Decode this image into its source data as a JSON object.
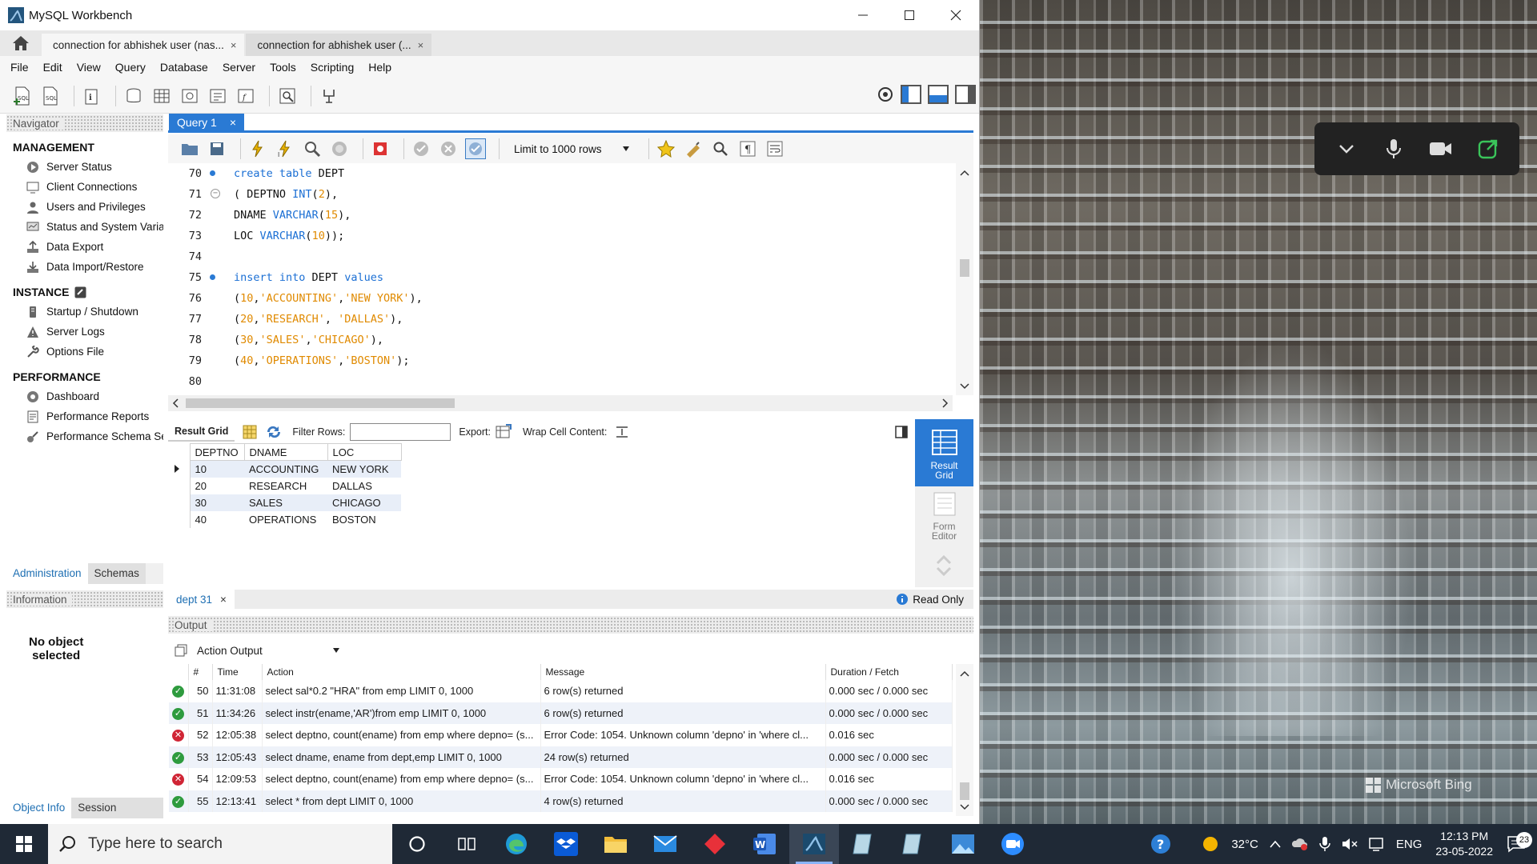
{
  "window": {
    "title": "MySQL Workbench",
    "conn_tabs": [
      {
        "label": "connection for abhishek user (nas...",
        "close": "×"
      },
      {
        "label": "connection for abhishek user (...",
        "close": "×"
      }
    ]
  },
  "menu": [
    "File",
    "Edit",
    "View",
    "Query",
    "Database",
    "Server",
    "Tools",
    "Scripting",
    "Help"
  ],
  "navigator": {
    "header": "Navigator",
    "management": {
      "title": "MANAGEMENT",
      "items": [
        "Server Status",
        "Client Connections",
        "Users and Privileges",
        "Status and System Variables",
        "Data Export",
        "Data Import/Restore"
      ]
    },
    "instance": {
      "title": "INSTANCE",
      "items": [
        "Startup / Shutdown",
        "Server Logs",
        "Options File"
      ]
    },
    "performance": {
      "title": "PERFORMANCE",
      "items": [
        "Dashboard",
        "Performance Reports",
        "Performance Schema Setup"
      ]
    },
    "tabs": [
      "Administration",
      "Schemas"
    ]
  },
  "information": {
    "header": "Information",
    "message_line1": "No object",
    "message_line2": "selected",
    "tabs": [
      "Object Info",
      "Session"
    ]
  },
  "query": {
    "tab_label": "Query 1",
    "tab_close": "×",
    "limit_label": "Limit to 1000 rows",
    "line_numbers": [
      "70",
      "71",
      "72",
      "73",
      "74",
      "75",
      "76",
      "77",
      "78",
      "79",
      "80"
    ],
    "code": {
      "l70_kw": "create table",
      "l70_rest": " DEPT",
      "l71_a": "( DEPTNO ",
      "l71_kw": "INT",
      "l71_b": "(",
      "l71_n": "2",
      "l71_c": "),",
      "l72_a": "DNAME ",
      "l72_kw": "VARCHAR",
      "l72_b": "(",
      "l72_n": "15",
      "l72_c": "),",
      "l73_a": "LOC ",
      "l73_kw": "VARCHAR",
      "l73_b": "(",
      "l73_n": "10",
      "l73_c": "));",
      "l75_kw1": "insert into",
      "l75_mid": " DEPT ",
      "l75_kw2": "values",
      "rows": [
        {
          "open": "(",
          "num": "10",
          "sep1": ",",
          "s1": "'ACCOUNTING'",
          "sep2": ",",
          "s2": "'NEW YORK'",
          "close": "),"
        },
        {
          "open": "(",
          "num": "20",
          "sep1": ",",
          "s1": "'RESEARCH'",
          "sep2": ", ",
          "s2": "'DALLAS'",
          "close": "),"
        },
        {
          "open": "(",
          "num": "30",
          "sep1": ",",
          "s1": "'SALES'",
          "sep2": ",",
          "s2": "'CHICAGO'",
          "close": "),"
        },
        {
          "open": "(",
          "num": "40",
          "sep1": ",",
          "s1": "'OPERATIONS'",
          "sep2": ",",
          "s2": "'BOSTON'",
          "close": ");"
        }
      ]
    }
  },
  "result": {
    "result_grid_label": "Result Grid",
    "filter_label": "Filter Rows:",
    "filter_value": "",
    "export_label": "Export:",
    "wrap_label": "Wrap Cell Content:",
    "columns": [
      "DEPTNO",
      "DNAME",
      "LOC"
    ],
    "rows": [
      [
        "10",
        "ACCOUNTING",
        "NEW YORK"
      ],
      [
        "20",
        "RESEARCH",
        "DALLAS"
      ],
      [
        "30",
        "SALES",
        "CHICAGO"
      ],
      [
        "40",
        "OPERATIONS",
        "BOSTON"
      ]
    ],
    "side_result_line1": "Result",
    "side_result_line2": "Grid",
    "side_form_line1": "Form",
    "side_form_line2": "Editor",
    "result_tab": "dept 31",
    "result_tab_close": "×",
    "read_only": "Read Only"
  },
  "output": {
    "header": "Output",
    "selector": "Action Output",
    "columns": [
      "#",
      "Time",
      "Action",
      "Message",
      "Duration / Fetch"
    ],
    "rows": [
      {
        "status": "ok",
        "num": "50",
        "time": "11:31:08",
        "action": "select sal*0.2 \"HRA\" from emp LIMIT 0, 1000",
        "message": "6 row(s) returned",
        "duration": "0.000 sec / 0.000 sec"
      },
      {
        "status": "ok",
        "num": "51",
        "time": "11:34:26",
        "action": "select instr(ename,'AR')from emp LIMIT 0, 1000",
        "message": "6 row(s) returned",
        "duration": "0.000 sec / 0.000 sec"
      },
      {
        "status": "err",
        "num": "52",
        "time": "12:05:38",
        "action": "select deptno, count(ename) from emp where depno= (s...",
        "message": "Error Code: 1054. Unknown column 'depno' in 'where cl...",
        "duration": "0.016 sec"
      },
      {
        "status": "ok",
        "num": "53",
        "time": "12:05:43",
        "action": "select  dname, ename from dept,emp LIMIT 0, 1000",
        "message": "24 row(s) returned",
        "duration": "0.000 sec / 0.000 sec"
      },
      {
        "status": "err",
        "num": "54",
        "time": "12:09:53",
        "action": "select deptno, count(ename) from emp where depno= (s...",
        "message": "Error Code: 1054. Unknown column 'depno' in 'where cl...",
        "duration": "0.016 sec"
      },
      {
        "status": "ok",
        "num": "55",
        "time": "12:13:41",
        "action": "select * from dept LIMIT 0, 1000",
        "message": "4 row(s) returned",
        "duration": "0.000 sec / 0.000 sec"
      }
    ]
  },
  "desktop": {
    "watermark": "Microsoft Bing"
  },
  "taskbar": {
    "search_placeholder": "Type here to search",
    "temperature": "32°C",
    "language": "ENG",
    "time": "12:13 PM",
    "date": "23-05-2022",
    "notification_count": "23"
  },
  "colors": {
    "accent": "#2a7ad4",
    "ok": "#2e9b3e",
    "error": "#d02535",
    "taskbar": "#1f2936"
  }
}
